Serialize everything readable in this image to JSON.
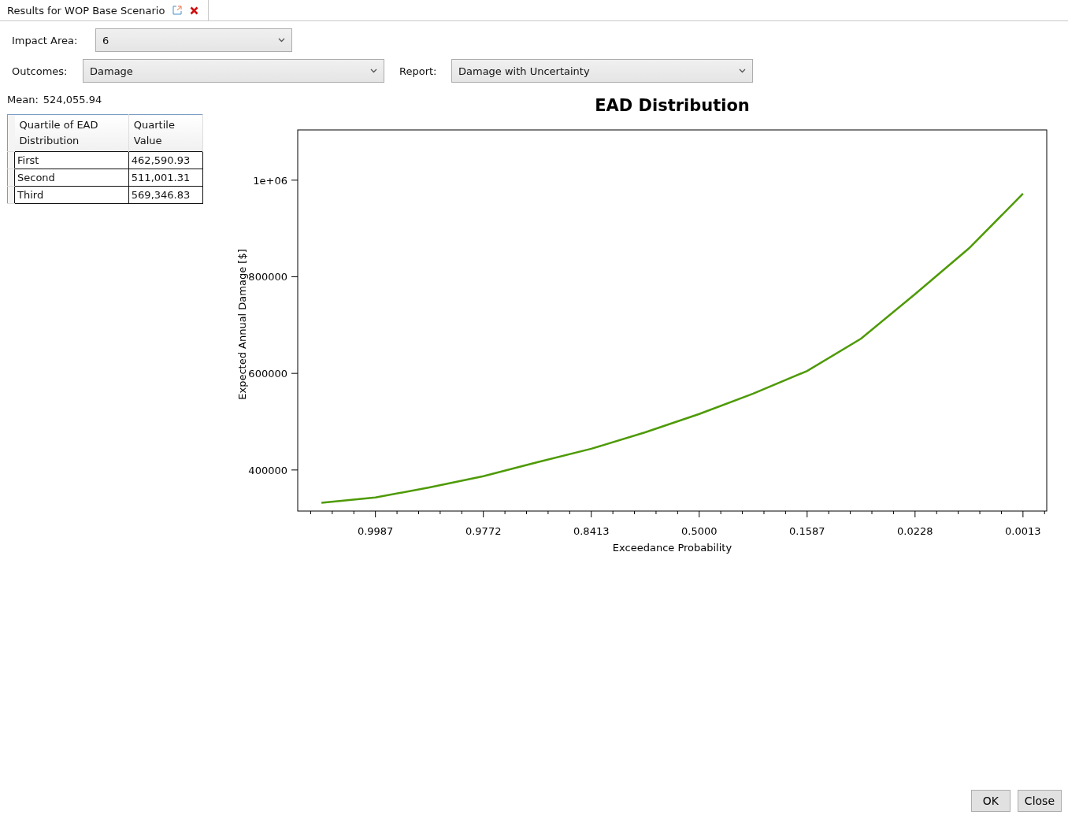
{
  "tab": {
    "title": "Results for WOP Base Scenario"
  },
  "impact_area": {
    "label": "Impact Area:",
    "value": "6"
  },
  "outcomes": {
    "label": "Outcomes:",
    "value": "Damage"
  },
  "report": {
    "label": "Report:",
    "value": "Damage with Uncertainty"
  },
  "mean": {
    "label": "Mean:",
    "value": "524,055.94"
  },
  "table": {
    "columns": [
      "Quartile of EAD Distribution",
      "Quartile Value"
    ],
    "rows": [
      [
        "First",
        "462,590.93"
      ],
      [
        "Second",
        "511,001.31"
      ],
      [
        "Third",
        "569,346.83"
      ]
    ]
  },
  "chart_data": {
    "type": "line",
    "title": "EAD Distribution",
    "xlabel": "Exceedance Probability",
    "ylabel": "Expected Annual Damage [$]",
    "categories": [
      null,
      "0.9987",
      null,
      "0.9772",
      null,
      "0.8413",
      null,
      "0.5000",
      null,
      "0.1587",
      null,
      "0.0228",
      null,
      "0.0013"
    ],
    "series": [
      {
        "color": "#4e9a06",
        "values": [
          332000,
          343000,
          364000,
          387000,
          416000,
          444000,
          478000,
          516000,
          558000,
          605000,
          672000,
          764000,
          859000,
          972000
        ]
      }
    ],
    "ylim": [
      315000,
      1104000
    ],
    "yticks": [
      {
        "value": 400000,
        "label": "400000"
      },
      {
        "value": 600000,
        "label": "600000"
      },
      {
        "value": 800000,
        "label": "800000"
      },
      {
        "value": 1000000,
        "label": "1e+06"
      }
    ]
  },
  "buttons": [
    "OK",
    "Close"
  ]
}
